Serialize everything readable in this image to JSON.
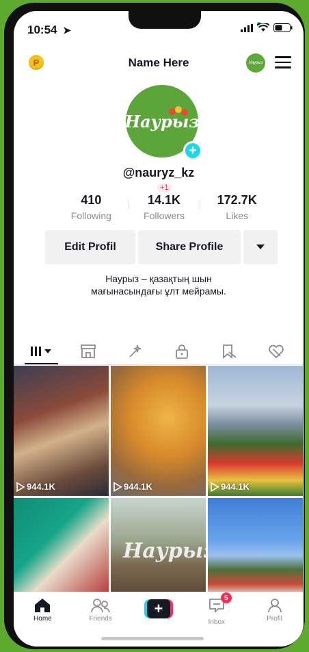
{
  "status_bar": {
    "time": "10:54"
  },
  "header": {
    "title": "Name Here",
    "coin_label": "P",
    "mini_logo_text": "Наурыз"
  },
  "profile": {
    "avatar_text": "Наурыз",
    "handle": "@nauryz_kz",
    "stats": [
      {
        "value": "410",
        "label": "Following"
      },
      {
        "value": "14.1K",
        "label": "Followers",
        "delta": "+1"
      },
      {
        "value": "172.7K",
        "label": "Likes"
      }
    ],
    "buttons": {
      "edit": "Edit Profil",
      "share": "Share Profile"
    },
    "bio_line1": "Наурыз – қазақтың шын",
    "bio_line2": "мағынасындағы ұлт мейрамы."
  },
  "grid": {
    "tiles": [
      {
        "views": "944.1K"
      },
      {
        "views": "944.1K"
      },
      {
        "views": "944.1K"
      },
      {
        "views": ""
      },
      {
        "views": "",
        "overlay": "Наурыз"
      },
      {
        "views": ""
      }
    ]
  },
  "nav": {
    "home": "Home",
    "friends": "Friends",
    "inbox": "Inbox",
    "inbox_badge": "5",
    "profile": "Profil"
  },
  "colors": {
    "accent": "#fe2c55",
    "cyan": "#20d5ec",
    "brand_green": "#5ca53a",
    "background": "#5eaa2f"
  }
}
